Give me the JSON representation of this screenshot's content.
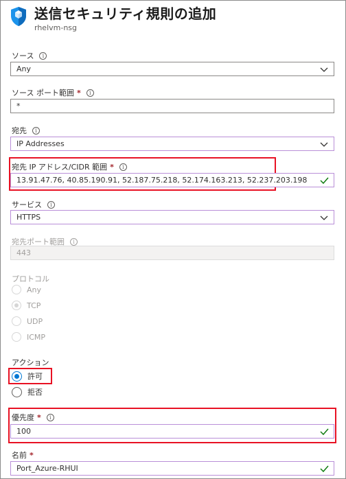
{
  "header": {
    "title": "送信セキュリティ規則の追加",
    "subtitle": "rhelvm-nsg",
    "icon": "shield-icon"
  },
  "form": {
    "source": {
      "label": "ソース",
      "value": "Any"
    },
    "source_port": {
      "label": "ソース ポート範囲",
      "required": "*",
      "value": "*"
    },
    "destination": {
      "label": "宛先",
      "value": "IP Addresses"
    },
    "destination_ip": {
      "label": "宛先 IP アドレス/CIDR 範囲",
      "required": "*",
      "value": "13.91.47.76, 40.85.190.91, 52.187.75.218, 52.174.163.213, 52.237.203.198"
    },
    "service": {
      "label": "サービス",
      "value": "HTTPS"
    },
    "destination_port": {
      "label": "宛先ポート範囲",
      "value": "443"
    },
    "protocol": {
      "label": "プロトコル",
      "options": [
        "Any",
        "TCP",
        "UDP",
        "ICMP"
      ],
      "selected": "TCP"
    },
    "action": {
      "label": "アクション",
      "options": [
        "許可",
        "拒否"
      ],
      "selected": "許可"
    },
    "priority": {
      "label": "優先度",
      "required": "*",
      "value": "100"
    },
    "name": {
      "label": "名前",
      "required": "*",
      "value": "Port_Azure-RHUI"
    }
  },
  "colors": {
    "accent": "#0078d4",
    "highlight": "#e81123",
    "valid_check": "#107c10",
    "field_border_focus": "#b98ed8"
  }
}
